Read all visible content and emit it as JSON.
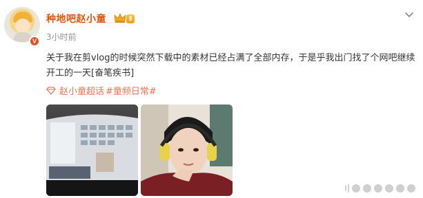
{
  "post": {
    "username": "种地吧赵小童",
    "level_badge": "Ⅱ",
    "verified_badge": "V",
    "timestamp": "3小时前",
    "content": "关于我在剪vlog的时候突然下载中的素材已经占满了全部内存，于是乎我出门找了个网吧继续开工的一天[奋笔疾书]",
    "topic_super": "赵小童超话",
    "topic_tag": "#童频日常#"
  },
  "images": [
    {
      "name": "video-editing-screen-photo"
    },
    {
      "name": "selfie-with-headphones-photo"
    }
  ],
  "colors": {
    "username": "#e2540b",
    "link": "#eb7350",
    "timestamp": "#939393"
  }
}
